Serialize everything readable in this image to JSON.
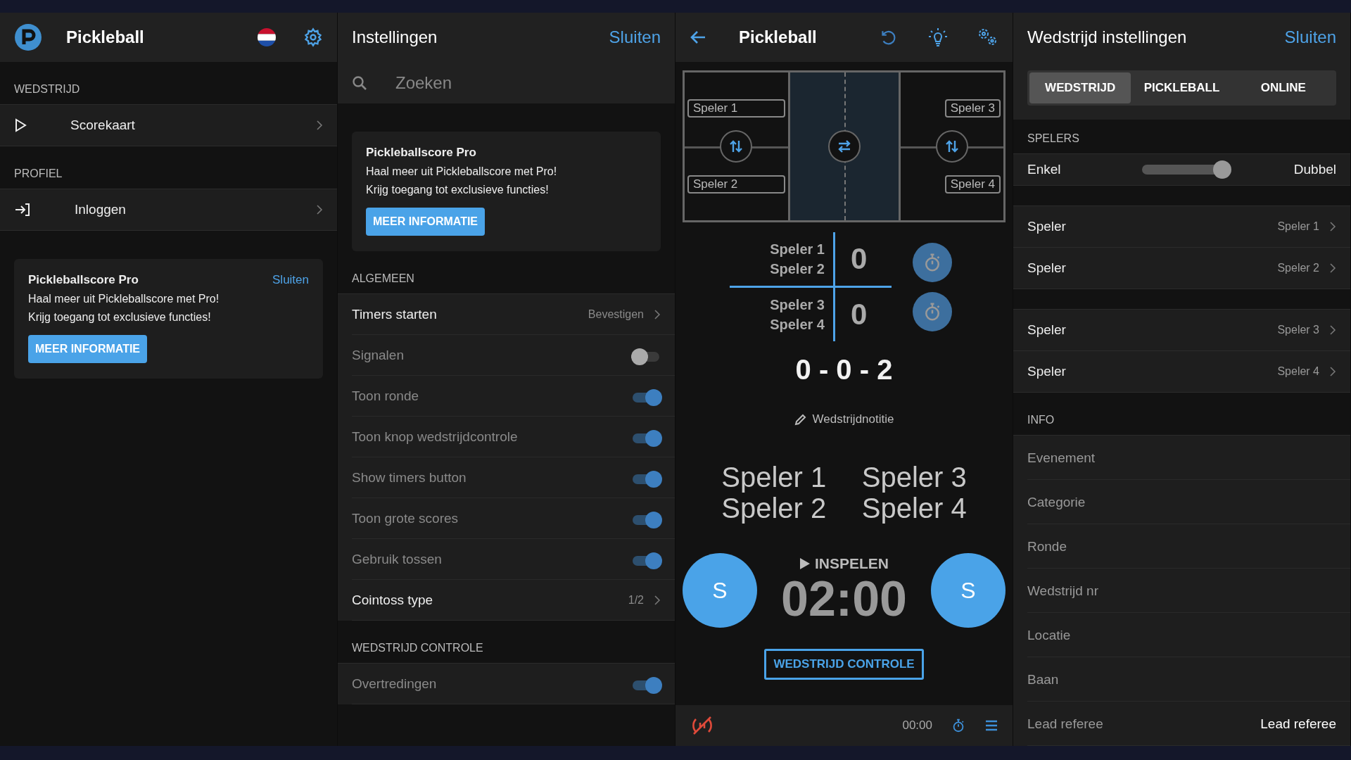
{
  "menu_panel": {
    "title": "Pickleball",
    "sections": [
      {
        "header": "WEDSTRIJD",
        "items": [
          {
            "label": "Scorekaart",
            "kind": "play"
          }
        ]
      },
      {
        "header": "PROFIEL",
        "items": [
          {
            "label": "Inloggen",
            "kind": "login"
          }
        ]
      }
    ],
    "promo": {
      "title": "Pickleballscore Pro",
      "close": "Sluiten",
      "lines": [
        "Haal meer uit Pickleballscore met Pro!",
        "Krijg toegang tot exclusieve functies!"
      ],
      "button": "MEER INFORMATIE"
    }
  },
  "settings_panel": {
    "title": "Instellingen",
    "close": "Sluiten",
    "search": {
      "placeholder": "Zoeken"
    },
    "promo": {
      "title": "Pickleballscore Pro",
      "lines": [
        "Haal meer uit Pickleballscore met Pro!",
        "Krijg toegang tot exclusieve functies!"
      ],
      "button": "MEER INFORMATIE"
    },
    "sections": [
      {
        "header": "ALGEMEEN",
        "rows": [
          {
            "kind": "link",
            "label": "Timers starten",
            "value": "Bevestigen"
          },
          {
            "kind": "toggle",
            "label": "Signalen",
            "on": false
          },
          {
            "kind": "toggle",
            "label": "Toon ronde",
            "on": true
          },
          {
            "kind": "toggle",
            "label": "Toon knop wedstrijdcontrole",
            "on": true
          },
          {
            "kind": "toggle",
            "label": "Show timers button",
            "on": true
          },
          {
            "kind": "toggle",
            "label": "Toon grote scores",
            "on": true
          },
          {
            "kind": "toggle",
            "label": "Gebruik tossen",
            "on": true
          },
          {
            "kind": "link",
            "label": "Cointoss type",
            "value": "1/2"
          }
        ]
      },
      {
        "header": "WEDSTRIJD CONTROLE",
        "rows": [
          {
            "kind": "toggle",
            "label": "Overtredingen",
            "on": true
          }
        ]
      }
    ]
  },
  "score_panel": {
    "title": "Pickleball",
    "court": {
      "left": [
        "Speler 1",
        "Speler 2"
      ],
      "right": [
        "Speler 3",
        "Speler 4"
      ]
    },
    "teams": [
      {
        "players": [
          "Speler 1",
          "Speler 2"
        ],
        "score": "0"
      },
      {
        "players": [
          "Speler 3",
          "Speler 4"
        ],
        "score": "0"
      }
    ],
    "game_score": "0 - 0 - 2",
    "note": "Wedstrijdnotitie",
    "names": [
      [
        "Speler 1",
        "Speler 2"
      ],
      [
        "Speler 3",
        "Speler 4"
      ]
    ],
    "phase": "INSPELEN",
    "timer": "02:00",
    "serve_buttons": [
      "S",
      "S"
    ],
    "control_button": "WEDSTRIJD CONTROLE",
    "bottom_time": "00:00"
  },
  "match_panel": {
    "title": "Wedstrijd instellingen",
    "close": "Sluiten",
    "tabs": [
      {
        "label": "WEDSTRIJD",
        "selected": true
      },
      {
        "label": "PICKLEBALL",
        "selected": false
      },
      {
        "label": "ONLINE",
        "selected": false
      }
    ],
    "players_header": "SPELERS",
    "mode": {
      "left": "Enkel",
      "right": "Dubbel",
      "level": 1
    },
    "player_groups": [
      [
        {
          "label": "Speler",
          "value": "Speler 1"
        },
        {
          "label": "Speler",
          "value": "Speler 2"
        }
      ],
      [
        {
          "label": "Speler",
          "value": "Speler 3"
        },
        {
          "label": "Speler",
          "value": "Speler 4"
        }
      ]
    ],
    "info_header": "INFO",
    "info_rows": [
      {
        "label": "Evenement"
      },
      {
        "label": "Categorie"
      },
      {
        "label": "Ronde"
      },
      {
        "label": "Wedstrijd nr"
      },
      {
        "label": "Locatie"
      },
      {
        "label": "Baan"
      },
      {
        "label": "Lead referee",
        "value": "Lead referee"
      }
    ]
  }
}
